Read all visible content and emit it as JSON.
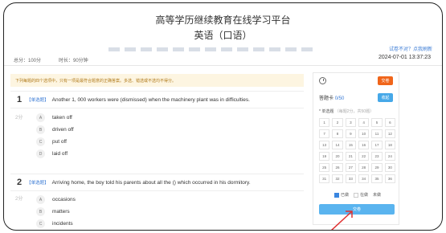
{
  "header": {
    "title": "高等学历继续教育在线学习平台",
    "subtitle": "英语（口语）",
    "hint_link": "试卷不对？点我刷新",
    "score": "总分：100分",
    "time_limit": "时长：90分钟",
    "datetime": "2024-07-01 13:37:23"
  },
  "instructions": "下列每题的四个选项中，只有一项是最符合题意的正确答案。多选、错选或不选均不得分。",
  "questions": [
    {
      "number": "1",
      "type": "【单选题】",
      "text": "Another 1, 000 workers were (dismissed) when the machinery plant was in difficulties.",
      "points": "2分",
      "options": [
        {
          "letter": "A",
          "text": "taken off"
        },
        {
          "letter": "B",
          "text": "driven off"
        },
        {
          "letter": "C",
          "text": "put off"
        },
        {
          "letter": "D",
          "text": "laid off"
        }
      ]
    },
    {
      "number": "2",
      "type": "【单选题】",
      "text": "Arriving home, the boy told his parents about all the () which occurred in his dormitory.",
      "points": "2分",
      "options": [
        {
          "letter": "A",
          "text": "occasions"
        },
        {
          "letter": "B",
          "text": "matters"
        },
        {
          "letter": "C",
          "text": "incidents"
        }
      ]
    }
  ],
  "sidebar": {
    "submit_top": "交卷",
    "answer_card_label": "答题卡",
    "answer_card_count": "0/50",
    "expand": "收起",
    "section_label": "* 单选题",
    "section_note": "（每题2分，共50题）",
    "cells": [
      "1",
      "2",
      "3",
      "4",
      "5",
      "6",
      "7",
      "8",
      "9",
      "10",
      "11",
      "12",
      "13",
      "14",
      "15",
      "16",
      "17",
      "18",
      "19",
      "20",
      "21",
      "22",
      "23",
      "24",
      "25",
      "26",
      "27",
      "28",
      "29",
      "30",
      "31",
      "32",
      "33",
      "34",
      "35",
      "36"
    ],
    "legend": [
      "已做",
      "在做",
      "未做"
    ],
    "submit_bottom": "交卷"
  },
  "colors": {
    "accent": "#3a7bd5",
    "submit": "#f0651a",
    "arrow": "#e03030"
  }
}
